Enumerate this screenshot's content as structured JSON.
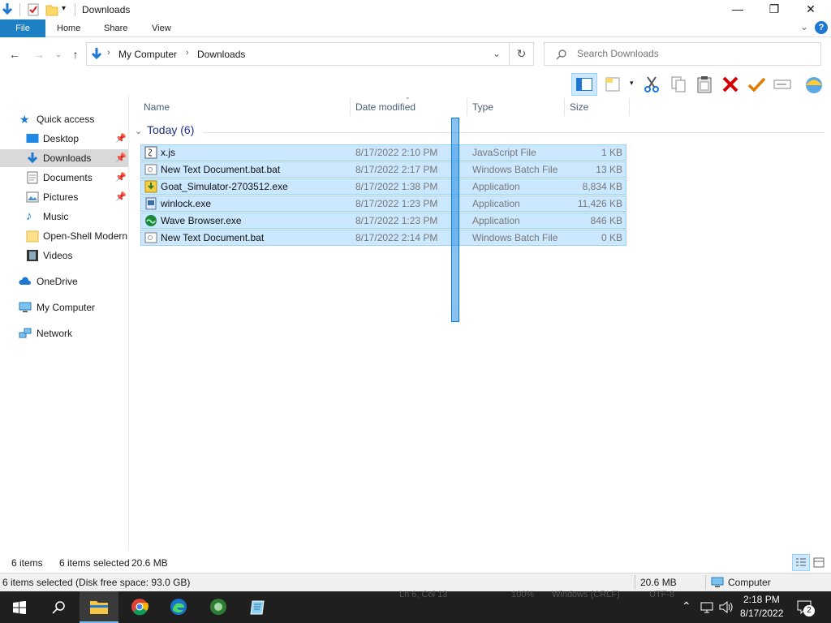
{
  "window": {
    "title": "Downloads",
    "minimize": "—",
    "maximize": "❐",
    "close": "✕"
  },
  "ribbon": {
    "tabs": [
      "File",
      "Home",
      "Share",
      "View"
    ],
    "expand": "⌄",
    "help": "?"
  },
  "address": {
    "crumbs": [
      "My Computer",
      "Downloads"
    ],
    "search_placeholder": "Search Downloads"
  },
  "nav": {
    "items": [
      {
        "label": "Quick access",
        "icon": "star-icon"
      },
      {
        "label": "Desktop",
        "icon": "desktop-icon",
        "pinned": true
      },
      {
        "label": "Downloads",
        "icon": "download-icon",
        "pinned": true,
        "selected": true
      },
      {
        "label": "Documents",
        "icon": "documents-icon",
        "pinned": true
      },
      {
        "label": "Pictures",
        "icon": "pictures-icon",
        "pinned": true
      },
      {
        "label": "Music",
        "icon": "music-icon"
      },
      {
        "label": "Open-Shell Modern",
        "icon": "folder-icon"
      },
      {
        "label": "Videos",
        "icon": "videos-icon"
      },
      {
        "label": "OneDrive",
        "icon": "cloud-icon"
      },
      {
        "label": "My Computer",
        "icon": "computer-icon"
      },
      {
        "label": "Network",
        "icon": "network-icon"
      }
    ]
  },
  "columns": [
    "Name",
    "Date modified",
    "Type",
    "Size"
  ],
  "group": {
    "label": "Today (6)"
  },
  "files": [
    {
      "name": "x.js",
      "date": "8/17/2022 2:10 PM",
      "type": "JavaScript File",
      "size": "1 KB",
      "icon": "script-icon"
    },
    {
      "name": "New Text Document.bat.bat",
      "date": "8/17/2022 2:17 PM",
      "type": "Windows Batch File",
      "size": "13 KB",
      "icon": "batch-file-icon"
    },
    {
      "name": "Goat_Simulator-2703512.exe",
      "date": "8/17/2022 1:38 PM",
      "type": "Application",
      "size": "8,834 KB",
      "icon": "installer-icon"
    },
    {
      "name": "winlock.exe",
      "date": "8/17/2022 1:23 PM",
      "type": "Application",
      "size": "11,426 KB",
      "icon": "app-icon"
    },
    {
      "name": "Wave Browser.exe",
      "date": "8/17/2022 1:23 PM",
      "type": "Application",
      "size": "846 KB",
      "icon": "wave-browser-icon"
    },
    {
      "name": "New Text Document.bat",
      "date": "8/17/2022 2:14 PM",
      "type": "Windows Batch File",
      "size": "0 KB",
      "icon": "batch-file-icon"
    }
  ],
  "status": {
    "count": "6 items",
    "selected": "6 items selected",
    "sel_size": "20.6 MB"
  },
  "status2": {
    "summary": "6 items selected (Disk free space: 93.0 GB)",
    "size": "20.6 MB",
    "location": "Computer"
  },
  "taskbar": {
    "behind_text": [
      "Ln 6, Col 13",
      "100%",
      "Windows (CRLF)",
      "UTF-8"
    ],
    "time": "2:18 PM",
    "date": "8/17/2022",
    "notifications": "2"
  }
}
